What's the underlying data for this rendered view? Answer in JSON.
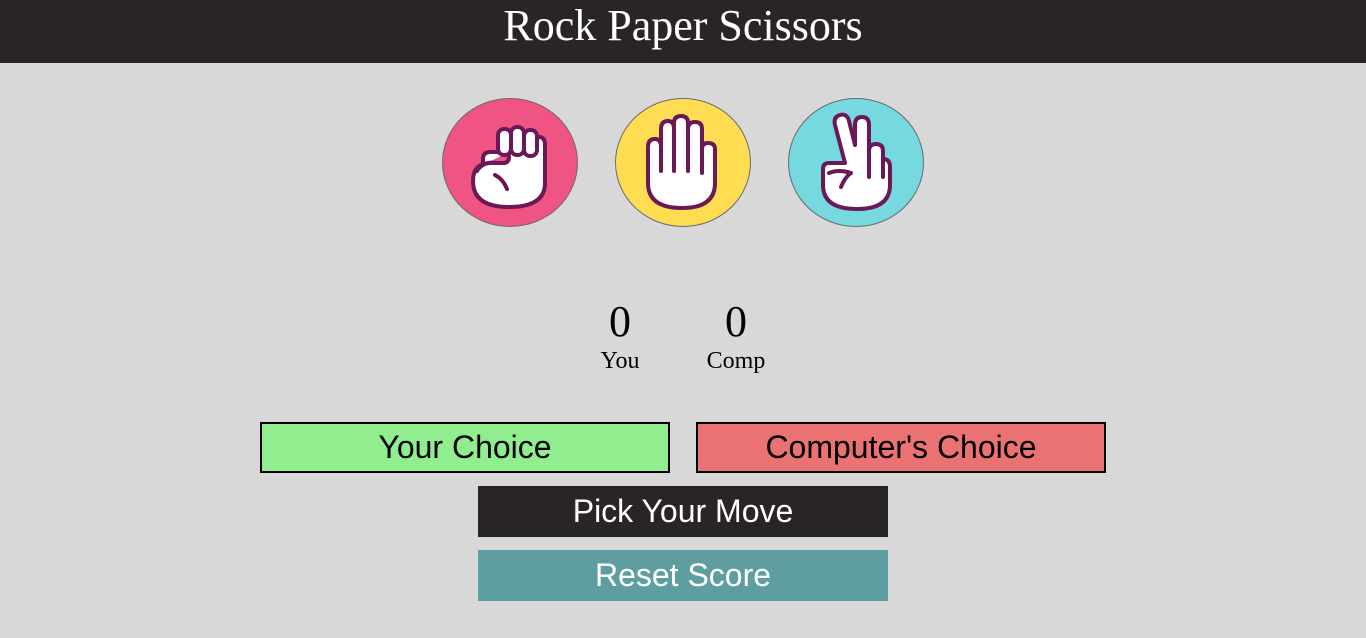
{
  "header": {
    "title": "Rock Paper Scissors"
  },
  "choices": [
    {
      "name": "rock",
      "icon": "fist-icon",
      "color": "#f05482"
    },
    {
      "name": "paper",
      "icon": "open-hand-icon",
      "color": "#fedd53"
    },
    {
      "name": "scissors",
      "icon": "peace-hand-icon",
      "color": "#76d9e0"
    }
  ],
  "scoreboard": {
    "player": {
      "score": "0",
      "label": "You"
    },
    "computer": {
      "score": "0",
      "label": "Comp"
    }
  },
  "result": {
    "your_choice_label": "Your Choice",
    "your_choice_color": "#90ee8f",
    "computer_choice_label": "Computer's Choice",
    "computer_choice_color": "#eb7272"
  },
  "actions": {
    "pick_move_label": "Pick Your Move",
    "pick_move_color": "#292525",
    "reset_label": "Reset Score",
    "reset_color": "#5f9ea0"
  },
  "colors": {
    "background": "#d8d8d8",
    "header_bg": "#292525",
    "icon_outline": "#6b1856"
  }
}
